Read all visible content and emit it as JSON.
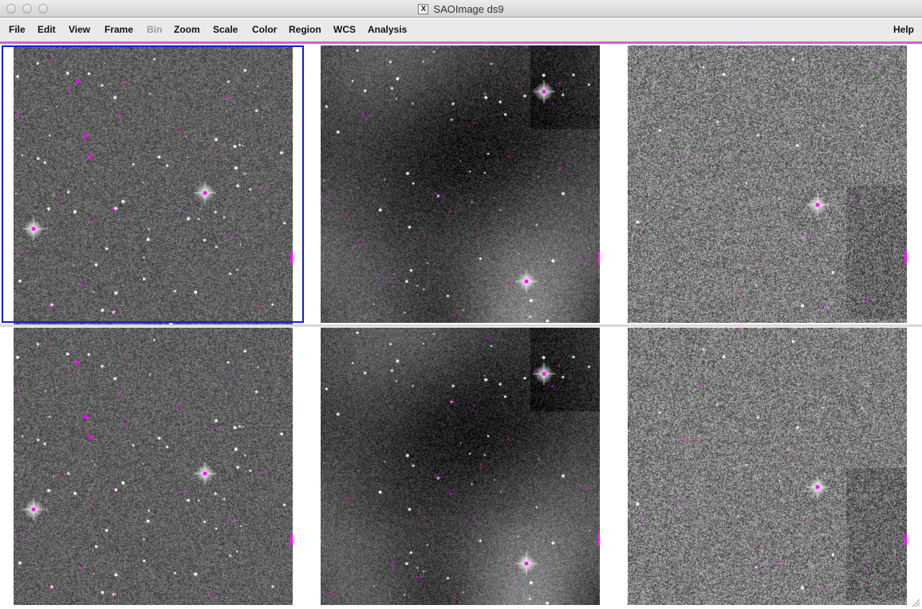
{
  "window": {
    "title": "SAOImage ds9",
    "logo_glyph": "X"
  },
  "menu": {
    "items": [
      "File",
      "Edit",
      "View",
      "Frame",
      "Bin",
      "Zoom",
      "Scale",
      "Color",
      "Region",
      "WCS",
      "Analysis"
    ],
    "disabled": [
      "Bin"
    ],
    "help_label": "Help"
  },
  "frames": {
    "layout": "tile 3x2",
    "active": 1,
    "items": [
      {
        "id": 1,
        "type": "noise",
        "brightness": 95,
        "contrast": 45,
        "stars": 80,
        "seed": 11
      },
      {
        "id": 2,
        "type": "nebula",
        "brightness": 60,
        "contrast": 35,
        "stars": 60,
        "seed": 23
      },
      {
        "id": 3,
        "type": "highnoise",
        "brightness": 125,
        "contrast": 70,
        "stars": 20,
        "seed": 37
      },
      {
        "id": 4,
        "type": "noise",
        "brightness": 95,
        "contrast": 45,
        "stars": 80,
        "seed": 11
      },
      {
        "id": 5,
        "type": "nebula",
        "brightness": 60,
        "contrast": 35,
        "stars": 60,
        "seed": 23
      },
      {
        "id": 6,
        "type": "highnoise",
        "brightness": 125,
        "contrast": 70,
        "stars": 20,
        "seed": 37
      }
    ]
  },
  "colors": {
    "region": "#ff00ff",
    "active_frame_border": "#1a1ad8",
    "separator": "#cc66cc"
  }
}
